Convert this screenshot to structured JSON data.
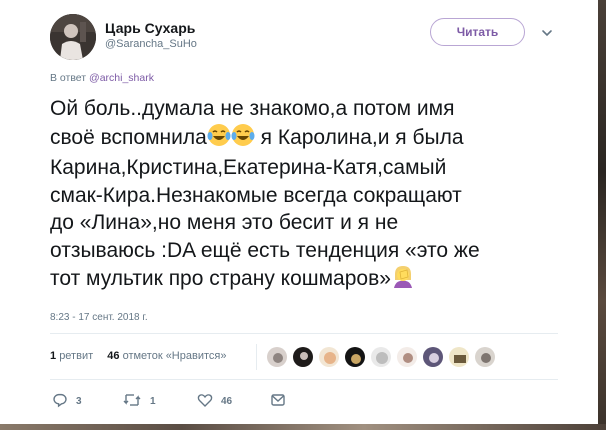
{
  "user": {
    "name": "Царь Сухарь",
    "handle": "@Sarancha_SuHo"
  },
  "follow_label": "Читать",
  "reply": {
    "prefix": "В ответ",
    "to": "@archi_shark"
  },
  "tweet": {
    "line1": "Ой боль..думала не знакомо,а потом имя",
    "line2a": "своё вспомнила",
    "line2b": " я Каролина,и я была",
    "line3": "Карина,Кристина,Екатерина-Катя,самый",
    "line4": "смак-Кира.Незнакомые всегда сокращают",
    "line5": "до «Лина»,но меня это бесит и я не",
    "line6": "отзываюсь :DA ещё есть тенденция «это же",
    "line7": "тот мультик про страну кошмаров»"
  },
  "timestamp": "8:23 - 17 сент. 2018 г.",
  "stats": {
    "retweets_count": "1",
    "retweets_label": "ретвит",
    "likes_count": "46",
    "likes_label": "отметок «Нравится»"
  },
  "actions": {
    "replies": "3",
    "retweets": "1",
    "likes": "46"
  },
  "icons": {
    "reply": "reply-icon",
    "retweet": "retweet-icon",
    "like": "heart-icon",
    "message": "direct-message-icon",
    "caret": "chevron-down-icon"
  },
  "colors": {
    "accent": "#7d5ba6",
    "muted": "#657786",
    "text": "#14171a"
  }
}
